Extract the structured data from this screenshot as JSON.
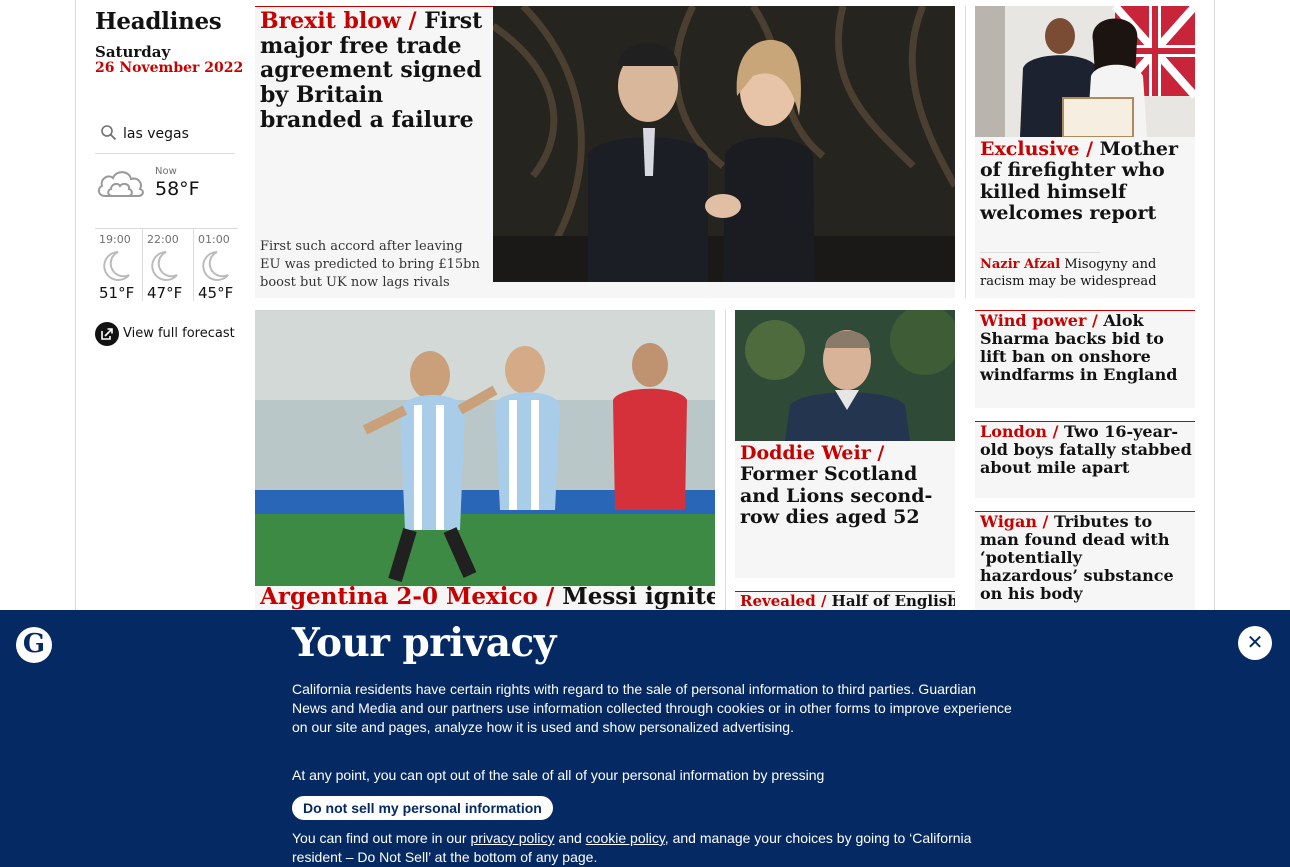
{
  "colors": {
    "accent": "#c70000",
    "banner": "#052962",
    "card": "#f6f6f6"
  },
  "sidebar": {
    "title": "Headlines",
    "day": "Saturday",
    "date": "26 November 2022",
    "weather": {
      "location": "las vegas",
      "now_label": "Now",
      "now_temp": "58°F",
      "now_icon": "cloud-icon",
      "forecast": [
        {
          "time": "19:00",
          "temp": "51°F",
          "icon": "moon-icon"
        },
        {
          "time": "22:00",
          "temp": "47°F",
          "icon": "moon-icon"
        },
        {
          "time": "01:00",
          "temp": "45°F",
          "icon": "moon-icon"
        }
      ],
      "full_forecast_label": "View full forecast"
    }
  },
  "stories": {
    "main": {
      "kicker": "Brexit blow / ",
      "headline": "First major free trade agreement signed by Britain branded a failure",
      "standfirst": "First such accord after leaving EU was predicted to bring £15bn boost but UK now lags rivals"
    },
    "exclusive": {
      "kicker": "Exclusive / ",
      "headline": "Mother of firefighter who killed himself welcomes report",
      "sub_kicker": "Nazir Afzal",
      "sub_text": "Misogyny and racism may be widespread"
    },
    "wind": {
      "kicker": "Wind power / ",
      "headline": "Alok Sharma backs bid to lift ban on onshore windfarms in England"
    },
    "london": {
      "kicker": "London / ",
      "headline": "Two 16-year-old boys fatally stabbed about mile apart"
    },
    "wigan": {
      "kicker": "Wigan / ",
      "headline": "Tributes to man found dead with ‘potentially hazardous’ substance on his body"
    },
    "doddie": {
      "kicker": "Doddie Weir / ",
      "headline": "Former Scotland and Lions second-row dies aged 52"
    },
    "messi": {
      "kicker": "Argentina 2-0 Mexico  / ",
      "headline": "Messi ignites"
    },
    "revealed": {
      "kicker": "Revealed  / ",
      "headline": "Half of English"
    }
  },
  "privacy": {
    "logo": "G",
    "title": "Your privacy",
    "para1": "California residents have certain rights with regard to the sale of personal information to third parties. Guardian News and Media and our partners use information collected through cookies or in other forms to improve experience on our site and pages, analyze how it is used and show personalized advertising.",
    "para2": "At any point, you can opt out of the sale of all of your personal information by pressing",
    "button": "Do not sell my personal information",
    "para3_a": "You can find out more in our ",
    "privacy_link": "privacy policy",
    "para3_b": " and ",
    "cookie_link": "cookie policy",
    "para3_c": ", and manage your choices by going to ‘California resident – Do Not Sell’ at the bottom of any page.",
    "close_glyph": "✕"
  }
}
